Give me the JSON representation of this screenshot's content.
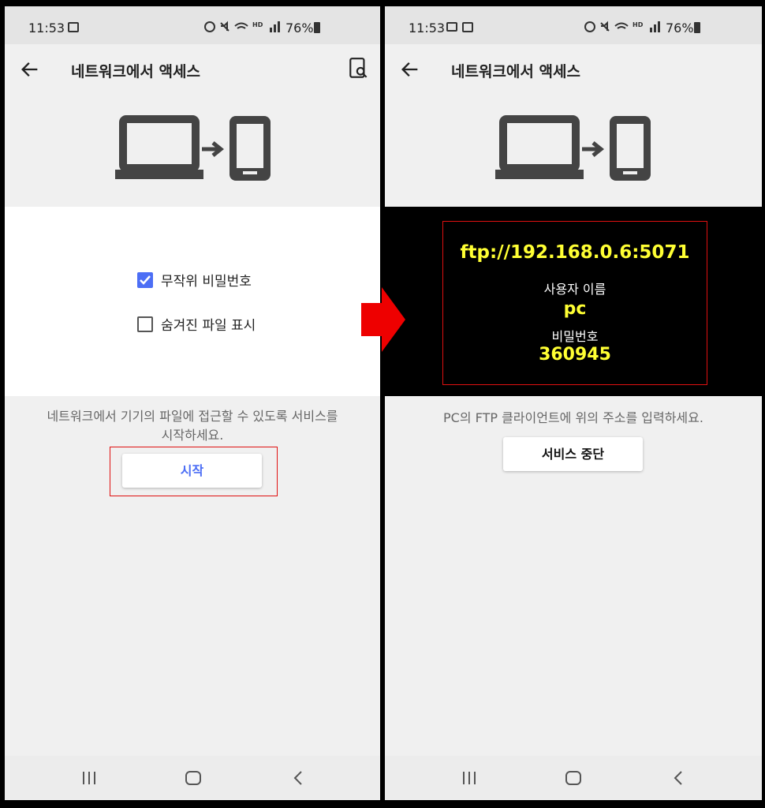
{
  "left": {
    "status": {
      "time": "11:53",
      "battery": "76%"
    },
    "appbar": {
      "title": "네트워크에서 액세스"
    },
    "options": [
      {
        "label": "무작위 비밀번호",
        "checked": true
      },
      {
        "label": "숨겨진 파일 표시",
        "checked": false
      }
    ],
    "description_line1": "네트워크에서 기기의 파일에 접근할 수 있도록 서비스를",
    "description_line2": "시작하세요.",
    "start_button": "시작"
  },
  "right": {
    "status": {
      "time": "11:53",
      "battery": "76%"
    },
    "appbar": {
      "title": "네트워크에서 액세스"
    },
    "ftp_address": "ftp://192.168.0.6:5071",
    "username_label": "사용자 이름",
    "username": "pc",
    "password_label": "비밀번호",
    "password": "360945",
    "description": "PC의 FTP 클라이언트에 위의 주소를 입력하세요.",
    "stop_button": "서비스 중단"
  },
  "colors": {
    "accent": "#4c6ef5",
    "highlight": "#ffff33",
    "callout": "#e01010"
  },
  "icons": [
    "back-arrow-icon",
    "storage-search-icon",
    "laptop-icon",
    "phone-icon",
    "recent-apps-icon",
    "home-icon",
    "nav-back-icon",
    "red-arrow-icon"
  ]
}
